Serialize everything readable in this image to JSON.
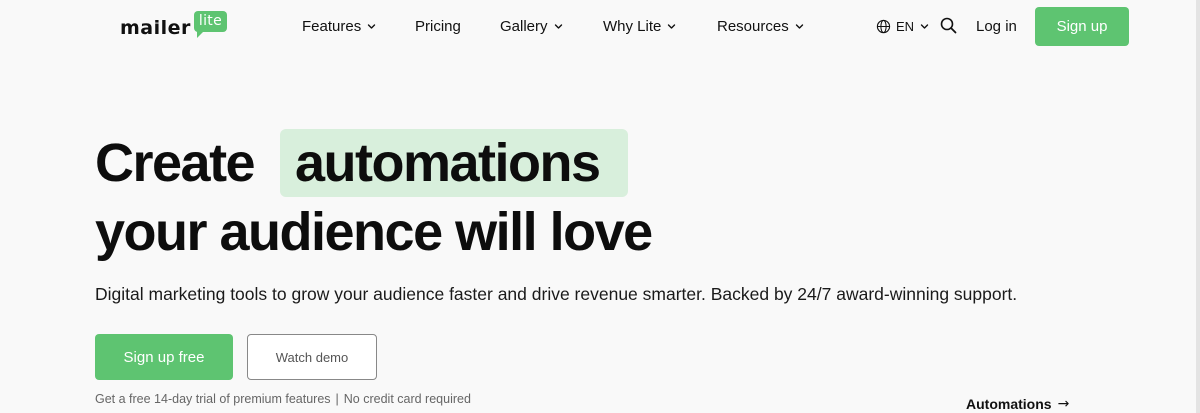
{
  "header": {
    "logo": {
      "word": "mailer",
      "badge": "lite"
    },
    "nav": [
      {
        "label": "Features",
        "has_dropdown": true
      },
      {
        "label": "Pricing",
        "has_dropdown": false
      },
      {
        "label": "Gallery",
        "has_dropdown": true
      },
      {
        "label": "Why Lite",
        "has_dropdown": true
      },
      {
        "label": "Resources",
        "has_dropdown": true
      }
    ],
    "language": {
      "label": "EN",
      "icon": "globe-icon"
    },
    "search_icon": "search-icon",
    "login_label": "Log in",
    "signup_label": "Sign up"
  },
  "hero": {
    "title_part1": "Create",
    "title_highlight": "automations",
    "title_line2": "your audience will love",
    "subtitle": "Digital marketing tools to grow your audience faster and drive revenue smarter. Backed by 24/7 award-winning support.",
    "primary_cta": "Sign up free",
    "secondary_cta": "Watch demo",
    "note_part1": "Get a free 14-day trial of premium features",
    "note_separator": "|",
    "note_part2": "No credit card required"
  },
  "feature_tab": {
    "label": "Automations",
    "arrow": "→"
  },
  "colors": {
    "brand_green": "#5ec471",
    "highlight_bg": "#d8efdc",
    "page_bg": "#f9f9f9",
    "text": "#111111"
  }
}
